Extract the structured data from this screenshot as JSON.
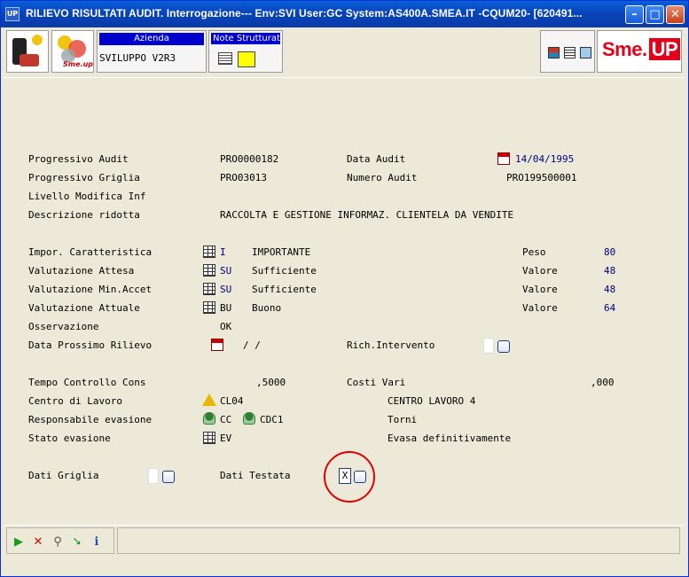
{
  "window": {
    "title": "RILIEVO RISULTATI AUDIT.  Interrogazione--- Env:SVI User:GC System:AS400A.SMEA.IT -CQUM20- [620491...",
    "app_icon_label": "UP"
  },
  "toolbar": {
    "azienda_label": "Azienda",
    "azienda_value": "SVILUPPO V2R3",
    "note_label": "Note Strutturate",
    "logo2_text": "Sme.up",
    "brand_sme": "Sme.",
    "brand_up": "UP"
  },
  "form": {
    "progressivo_audit": {
      "label": "Progressivo Audit",
      "value": "PRO0000182"
    },
    "data_audit": {
      "label": "Data Audit",
      "value": "14/04/1995"
    },
    "progressivo_griglia": {
      "label": "Progressivo Griglia",
      "value": "PRO03013"
    },
    "numero_audit": {
      "label": "Numero Audit",
      "value": "PRO199500001"
    },
    "livello_modifica": {
      "label": "Livello Modifica Inf"
    },
    "descrizione": {
      "label": "Descrizione ridotta",
      "value": "RACCOLTA E GESTIONE INFORMAZ. CLIENTELA DA VENDITE"
    },
    "impor_caratteristica": {
      "label": "Impor. Caratteristica",
      "code": "I",
      "desc": "IMPORTANTE",
      "peso_label": "Peso",
      "peso": "80"
    },
    "valutazione_attesa": {
      "label": "Valutazione Attesa",
      "code": "SU",
      "desc": "Sufficiente",
      "valore_label": "Valore",
      "valore": "48"
    },
    "valutazione_min": {
      "label": "Valutazione Min.Accet",
      "code": "SU",
      "desc": "Sufficiente",
      "valore_label": "Valore",
      "valore": "48"
    },
    "valutazione_attuale": {
      "label": "Valutazione Attuale",
      "code": "BU",
      "desc": "Buono",
      "valore_label": "Valore",
      "valore": "64"
    },
    "osservazione": {
      "label": "Osservazione",
      "value": "OK"
    },
    "data_prossimo": {
      "label": "Data Prossimo Rilievo",
      "value": "/  /"
    },
    "rich_intervento": {
      "label": "Rich.Intervento"
    },
    "tempo_controllo": {
      "label": "Tempo Controllo Cons",
      "value": ",5000"
    },
    "costi_vari": {
      "label": "Costi Vari",
      "value": ",000"
    },
    "centro_lavoro": {
      "label": "Centro di Lavoro",
      "code": "CL04",
      "desc": "CENTRO LAVORO 4"
    },
    "responsabile": {
      "label": "Responsabile evasione",
      "code1": "CC",
      "code2": "CDC1",
      "desc": "Torni"
    },
    "stato_evasione": {
      "label": "Stato evasione",
      "code": "EV",
      "desc": "Evasa definitivamente"
    },
    "dati_griglia": {
      "label": "Dati Griglia"
    },
    "dati_testata": {
      "label": "Dati Testata",
      "value": "X"
    }
  },
  "colors": {
    "title_bar": "#0842b8",
    "field_value": "#000080",
    "highlight_circle": "#e00000",
    "brand": "#e3001b"
  }
}
